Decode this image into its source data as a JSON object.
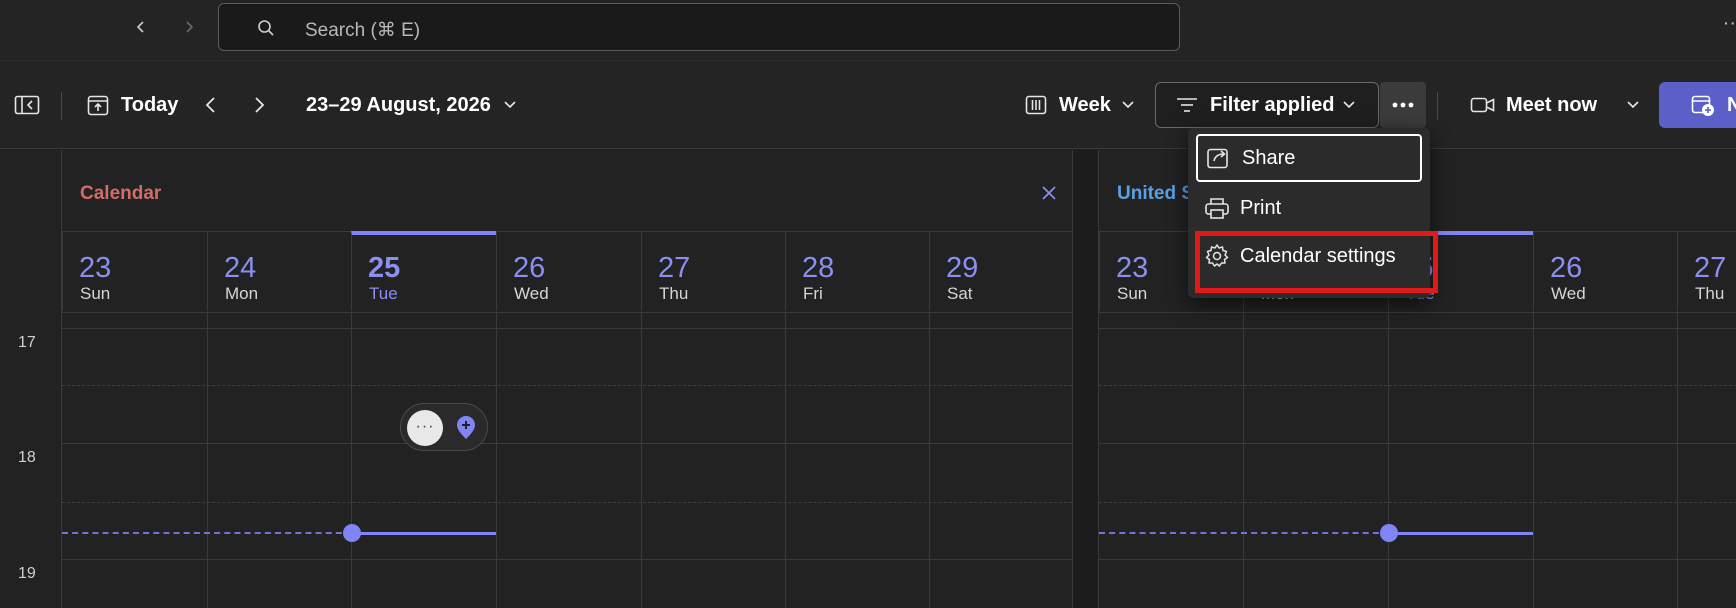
{
  "search": {
    "placeholder": "Search (⌘ E)"
  },
  "toolbar": {
    "today_label": "Today",
    "date_range": "23–29 August, 2026",
    "view_label": "Week",
    "filter_label": "Filter applied",
    "meet_now_label": "Meet now",
    "new_label": "N"
  },
  "more_menu": {
    "items": [
      {
        "label": "Share",
        "icon": "share-icon"
      },
      {
        "label": "Print",
        "icon": "printer-icon"
      },
      {
        "label": "Calendar settings",
        "icon": "gear-icon"
      }
    ]
  },
  "calendars": [
    {
      "name": "Calendar",
      "name_color": "#d46b6b",
      "days": [
        {
          "num": "23",
          "name": "Sun"
        },
        {
          "num": "24",
          "name": "Mon"
        },
        {
          "num": "25",
          "name": "Tue",
          "today": true
        },
        {
          "num": "26",
          "name": "Wed"
        },
        {
          "num": "27",
          "name": "Thu"
        },
        {
          "num": "28",
          "name": "Fri"
        },
        {
          "num": "29",
          "name": "Sat"
        }
      ]
    },
    {
      "name": "United S",
      "name_color": "#5aa0e6",
      "days": [
        {
          "num": "23",
          "name": "Sun"
        },
        {
          "num": "",
          "name": "Mon"
        },
        {
          "num": "5",
          "name": "Tue",
          "today": true
        },
        {
          "num": "26",
          "name": "Wed"
        },
        {
          "num": "27",
          "name": "Thu"
        }
      ]
    }
  ],
  "hours": [
    "17",
    "18",
    "19"
  ],
  "day_pill": {
    "more_label": "···"
  },
  "colors": {
    "accent": "#7f85f5",
    "highlight": "#e01919",
    "new_button": "#5b5fc7"
  }
}
